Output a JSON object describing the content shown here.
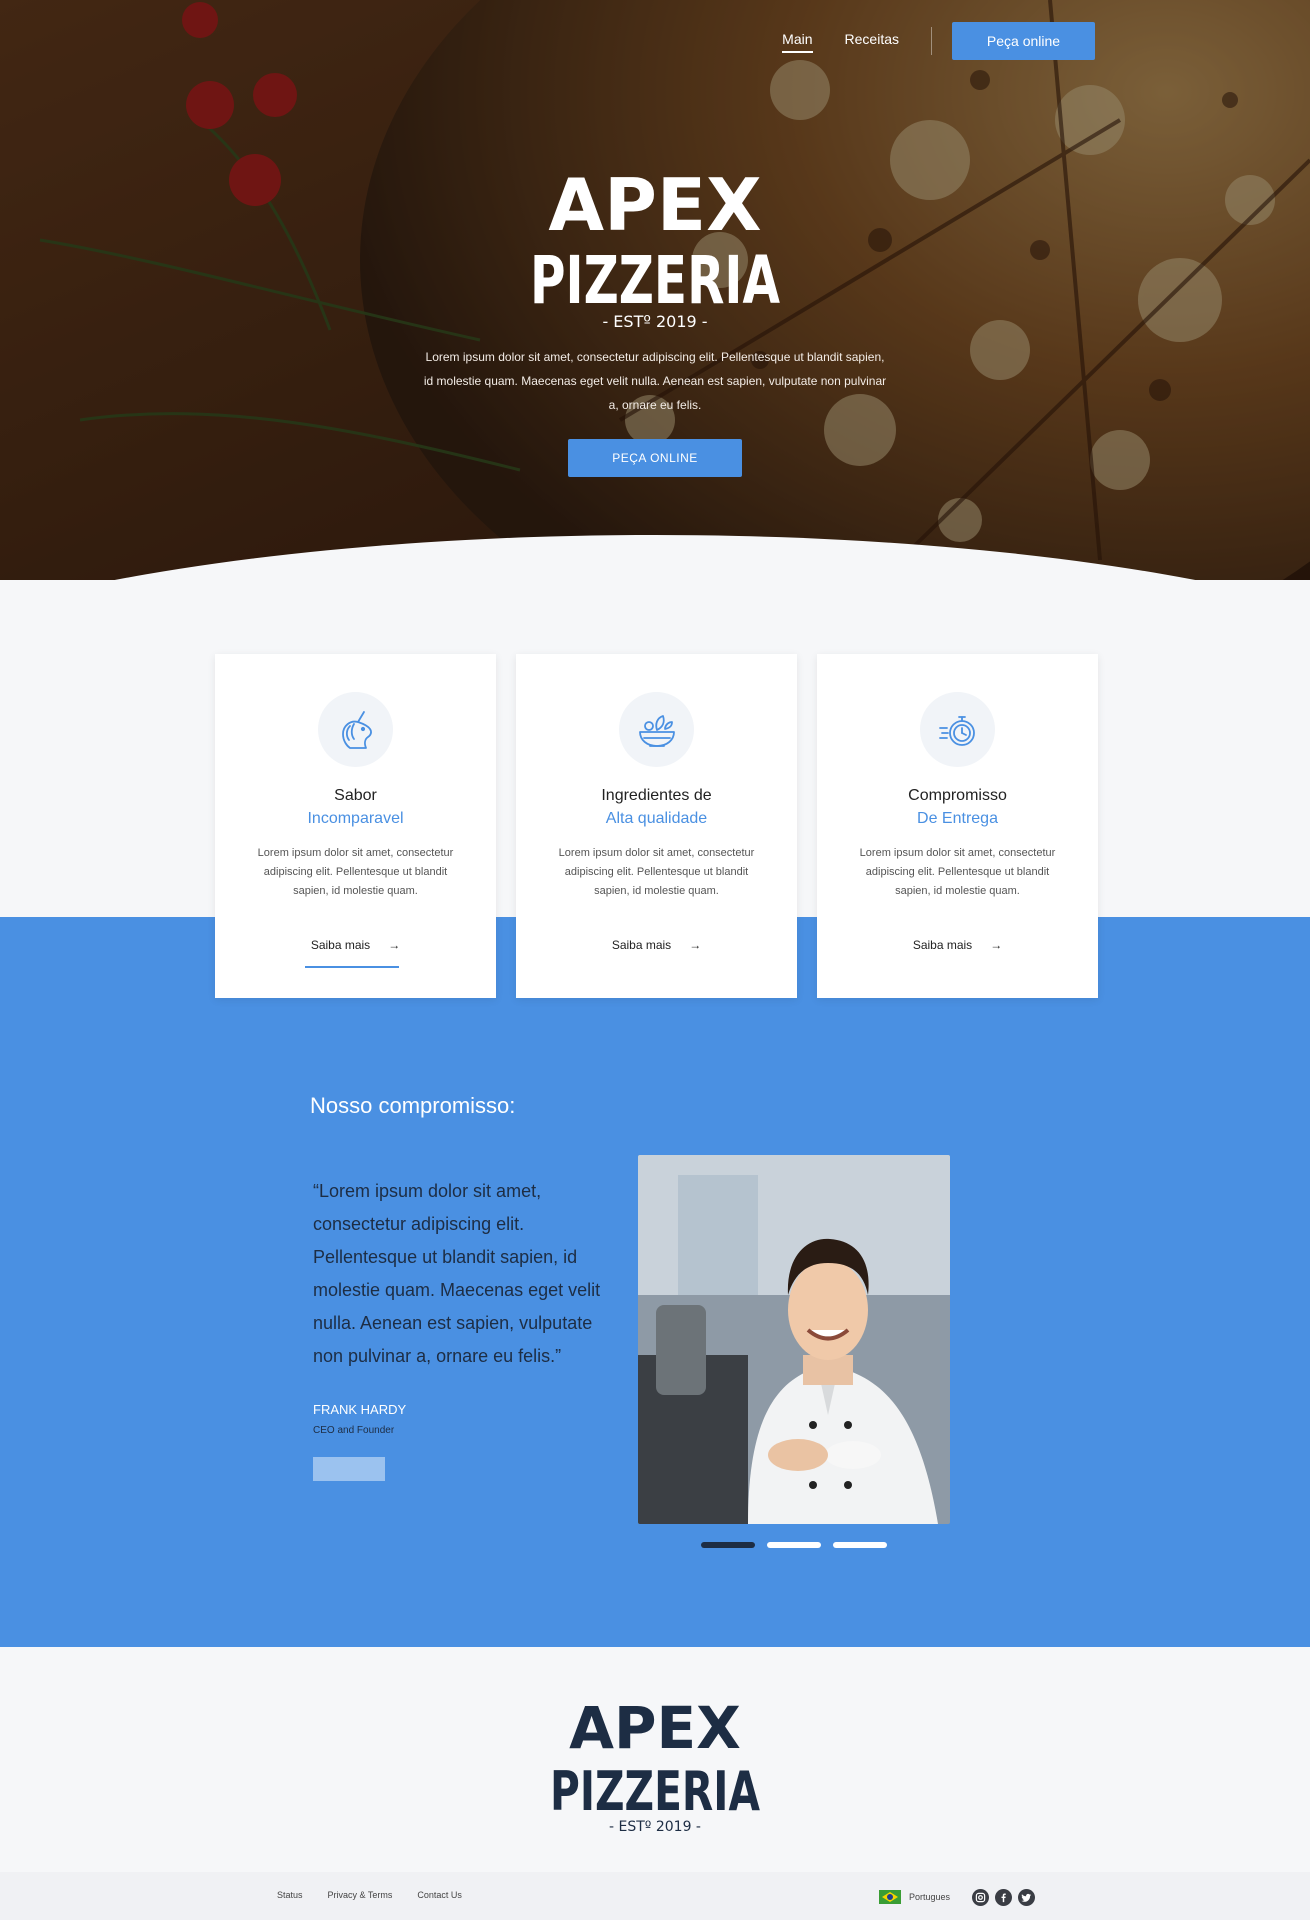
{
  "nav": {
    "links": [
      {
        "label": "Main",
        "active": true
      },
      {
        "label": "Receitas",
        "active": false
      }
    ],
    "order_button": "Peça online"
  },
  "hero": {
    "logo": {
      "line1": "APEX",
      "line2": "PIZZERIA",
      "tagline": "- ESTº 2019 -"
    },
    "text": "Lorem ipsum dolor sit amet, consectetur adipiscing elit. Pellentesque ut blandit sapien, id molestie quam. Maecenas eget velit nulla. Aenean est sapien, vulputate non pulvinar a, ornare eu felis.",
    "button": "PEÇA ONLINE"
  },
  "cards": [
    {
      "icon": "unicorn-icon",
      "title": "Sabor",
      "subtitle": "Incomparavel",
      "text": "Lorem ipsum dolor sit amet, consectetur adipiscing elit. Pellentesque ut blandit sapien, id molestie quam.",
      "link": "Saiba mais"
    },
    {
      "icon": "salad-bowl-icon",
      "title": "Ingredientes de",
      "subtitle": "Alta qualidade",
      "text": "Lorem ipsum dolor sit amet, consectetur adipiscing elit. Pellentesque ut blandit sapien, id molestie quam.",
      "link": "Saiba mais"
    },
    {
      "icon": "stopwatch-icon",
      "title": "Compromisso",
      "subtitle": "De Entrega",
      "text": "Lorem ipsum dolor sit amet, consectetur adipiscing elit. Pellentesque ut blandit sapien, id molestie quam.",
      "link": "Saiba mais"
    }
  ],
  "commitment": {
    "title": "Nosso compromisso:",
    "quote": "“Lorem ipsum dolor sit amet, consectetur adipiscing elit. Pellentesque ut blandit sapien, id molestie quam. Maecenas eget velit nulla. Aenean est sapien, vulputate non pulvinar a, ornare eu felis.”",
    "author": "FRANK HARDY",
    "role": "CEO and Founder",
    "active_slide": 1,
    "slide_count": 3
  },
  "footer": {
    "logo": {
      "line1": "APEX",
      "line2": "PIZZERIA",
      "tagline": "- ESTº 2019 -"
    },
    "links": [
      "Status",
      "Privacy & Terms",
      "Contact Us"
    ],
    "language": "Portugues",
    "socials": [
      "instagram-icon",
      "facebook-icon",
      "twitter-icon"
    ]
  },
  "colors": {
    "accent": "#4a90e2",
    "dark": "#1d2d44",
    "background": "#f6f7f9"
  }
}
